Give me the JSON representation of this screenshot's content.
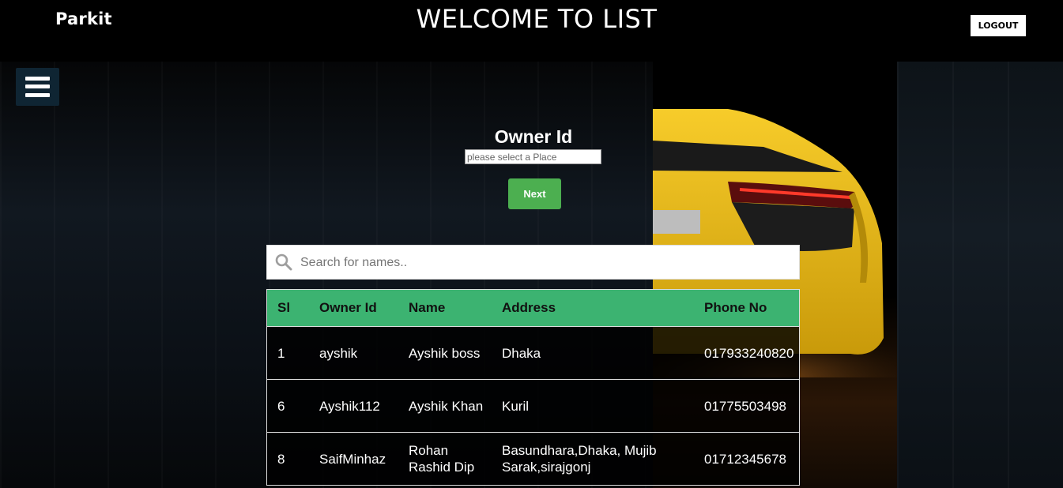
{
  "header": {
    "brand": "Parkit",
    "title": "WELCOME TO LIST",
    "logout_label": "LOGOUT"
  },
  "menu": {
    "icon": "hamburger-menu-icon"
  },
  "form": {
    "owner_label": "Owner Id",
    "place_placeholder": "please select a Place",
    "next_label": "Next"
  },
  "search": {
    "icon": "search-icon",
    "placeholder": "Search for names.."
  },
  "table": {
    "columns": [
      "Sl",
      "Owner Id",
      "Name",
      "Address",
      "Phone No"
    ],
    "rows": [
      [
        "1",
        "ayshik",
        "Ayshik boss",
        "Dhaka",
        "017933240820"
      ],
      [
        "6",
        "Ayshik112",
        "Ayshik Khan",
        "Kuril",
        "01775503498"
      ],
      [
        "8",
        "SaifMinhaz",
        "Rohan Rashid Dip",
        "Basundhara,Dhaka, Mujib Sarak,sirajgonj",
        "01712345678"
      ]
    ]
  },
  "colors": {
    "header_background": "#000000",
    "table_header": "#3cb371",
    "next_button": "#4caf50",
    "menu_button": "#0f2533",
    "car_body": "#f5c518"
  }
}
